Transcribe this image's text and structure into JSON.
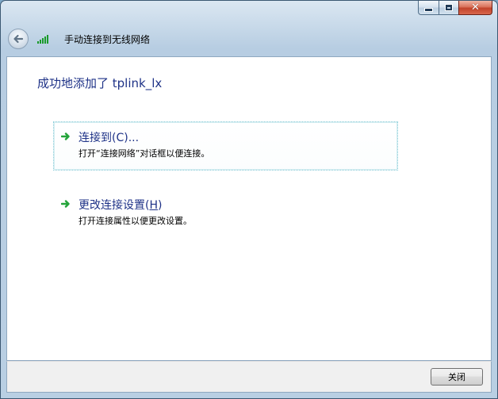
{
  "window": {
    "title_controls": [
      "minimize",
      "maximize",
      "close"
    ],
    "accent_color": "#1e3287",
    "close_color": "#c2432b"
  },
  "nav": {
    "back_icon": "back-arrow-icon",
    "network_icon": "wireless-signal-icon",
    "title": "手动连接到无线网络"
  },
  "content": {
    "heading": "成功地添加了 tplink_lx",
    "tasks": [
      {
        "label": "连接到(C)...",
        "description": "打开“连接网络”对话框以便连接。",
        "icon": "green-arrow-icon",
        "highlighted": true
      },
      {
        "label_prefix": "更改连接设置(",
        "label_accel": "H",
        "label_suffix": ")",
        "description": "打开连接属性以便更改设置。",
        "icon": "green-arrow-icon",
        "highlighted": false
      }
    ]
  },
  "footer": {
    "close_label": "关闭"
  }
}
